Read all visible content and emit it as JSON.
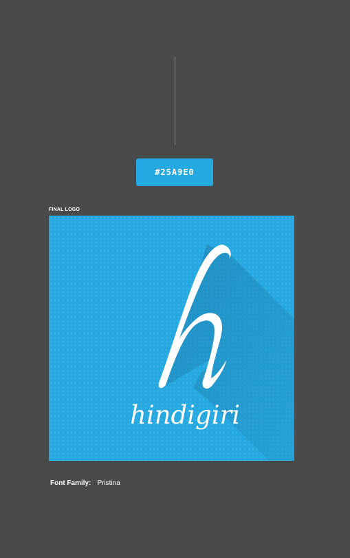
{
  "swatch": {
    "hex_label": "#25A9E0",
    "color": "#25A9E0"
  },
  "section": {
    "label": "FINAL LOGO"
  },
  "logo": {
    "wordmark": "hindigiri",
    "monogram": "h",
    "background_color": "#25A9E0",
    "shadow_color": "#1e88bd",
    "mark_color": "#ffffff"
  },
  "typography": {
    "label": "Font Family:",
    "value": "Pristina"
  }
}
